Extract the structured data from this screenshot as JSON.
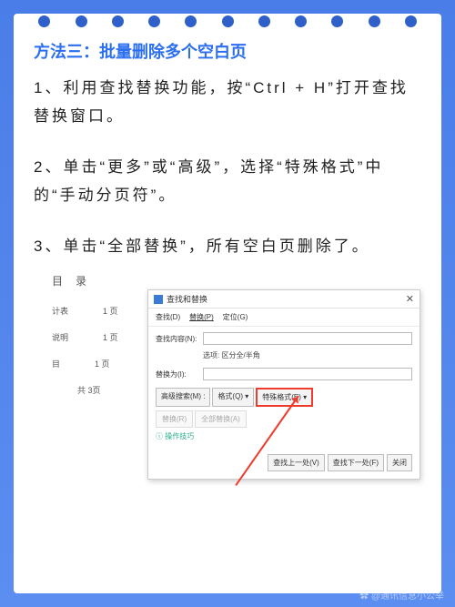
{
  "title": "方法三：批量删除多个空白页",
  "steps": {
    "s1": "1、利用查找替换功能，按“Ctrl + H”打开查找替换窗口。",
    "s2": "2、单击“更多”或“高级”，选择“特殊格式”中的“手动分页符”。",
    "s3": "3、单击“全部替换”，所有空白页删除了。"
  },
  "doc": {
    "heading": "目录",
    "rows": [
      {
        "a": "计表",
        "b": "1 页"
      },
      {
        "a": "说明",
        "b": "1 页"
      },
      {
        "a": "目",
        "b": "1 页"
      }
    ],
    "total": "共  3页"
  },
  "dialog": {
    "title": "查找和替换",
    "tabs": {
      "find": "查找(D)",
      "replace": "替换(P)",
      "goto": "定位(G)"
    },
    "findLabel": "查找内容(N):",
    "optsLabel": "选项:",
    "optsValue": "区分全/半角",
    "replaceLabel": "替换为(I):",
    "advSearch": "高级搜索(M) :",
    "format": "格式(Q) ▾",
    "special": "特殊格式(E) ▾",
    "replaceBtn": "替换(R)",
    "replaceAll": "全部替换(A)",
    "hint": "操作技巧",
    "findNext": "查找上一处(V)",
    "findPrev": "查找下一处(F)",
    "close": "关闭"
  },
  "watermark": "✿ @通讯信息小公举"
}
